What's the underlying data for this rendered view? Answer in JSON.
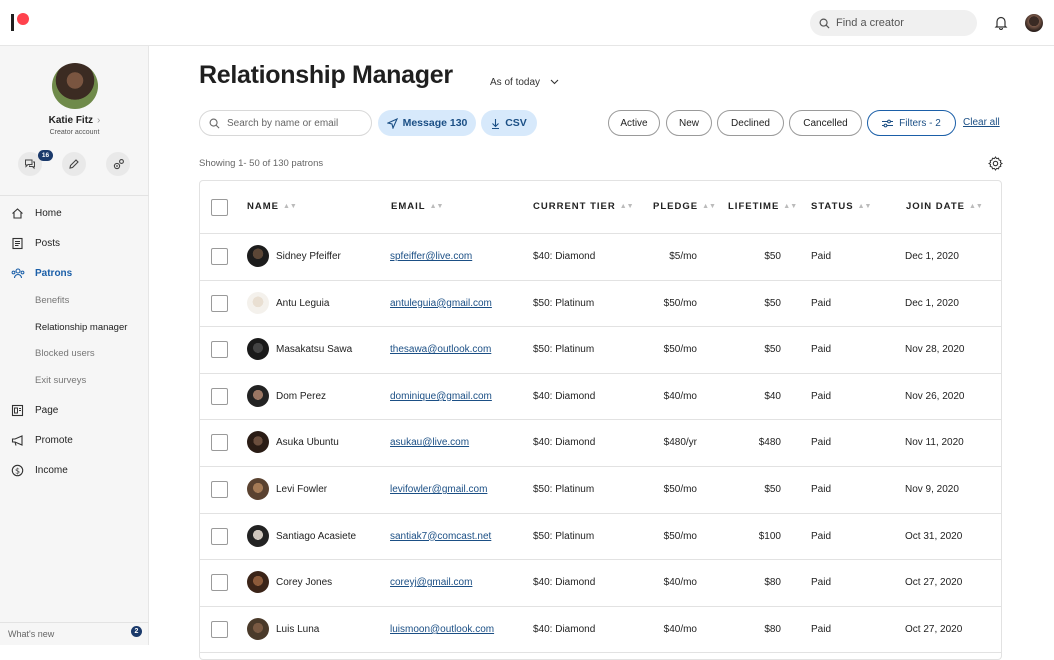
{
  "topbar": {
    "search_placeholder": "Find a creator"
  },
  "sidebar": {
    "profile_name": "Katie Fitz",
    "profile_role": "Creator account",
    "messages_badge": "16",
    "nav": [
      {
        "label": "Home",
        "icon": "home-icon"
      },
      {
        "label": "Posts",
        "icon": "posts-icon"
      },
      {
        "label": "Patrons",
        "icon": "patrons-icon"
      },
      {
        "label": "Page",
        "icon": "page-icon"
      },
      {
        "label": "Promote",
        "icon": "megaphone-icon"
      },
      {
        "label": "Income",
        "icon": "dollar-icon"
      }
    ],
    "patrons_sub": [
      "Benefits",
      "Relationship manager",
      "Blocked users",
      "Exit surveys"
    ],
    "whats_new": "What's new",
    "whats_new_badge": "2"
  },
  "main": {
    "title": "Relationship Manager",
    "as_of_prefix": "As of",
    "as_of_value": "today",
    "search_placeholder": "Search by name or email",
    "message_label": "Message 130",
    "csv_label": "CSV",
    "filters": [
      "Active",
      "New",
      "Declined",
      "Cancelled"
    ],
    "filters_button": "Filters - 2",
    "clear_all": "Clear all",
    "showing": "Showing 1- 50 of 130 patrons"
  },
  "table": {
    "columns": [
      "NAME",
      "EMAIL",
      "CURRENT TIER",
      "PLEDGE",
      "LIFETIME",
      "STATUS",
      "JOIN DATE"
    ],
    "rows": [
      {
        "name": "Sidney Pfeiffer",
        "email": "spfeiffer@live.com",
        "tier": "$40: Diamond",
        "pledge": "$5/mo",
        "lifetime": "$50",
        "status": "Paid",
        "join": "Dec 1, 2020"
      },
      {
        "name": "Antu Leguia",
        "email": "antuleguia@gmail.com",
        "tier": "$50: Platinum",
        "pledge": "$50/mo",
        "lifetime": "$50",
        "status": "Paid",
        "join": "Dec 1, 2020"
      },
      {
        "name": "Masakatsu Sawa",
        "email": "thesawa@outlook.com",
        "tier": "$50: Platinum",
        "pledge": "$50/mo",
        "lifetime": "$50",
        "status": "Paid",
        "join": "Nov 28, 2020"
      },
      {
        "name": "Dom Perez",
        "email": "dominique@gmail.com",
        "tier": "$40: Diamond",
        "pledge": "$40/mo",
        "lifetime": "$40",
        "status": "Paid",
        "join": "Nov 26, 2020"
      },
      {
        "name": "Asuka Ubuntu",
        "email": "asukau@live.com",
        "tier": "$40: Diamond",
        "pledge": "$480/yr",
        "lifetime": "$480",
        "status": "Paid",
        "join": "Nov 11, 2020"
      },
      {
        "name": "Levi Fowler",
        "email": "levifowler@gmail.com",
        "tier": "$50: Platinum",
        "pledge": "$50/mo",
        "lifetime": "$50",
        "status": "Paid",
        "join": "Nov 9, 2020"
      },
      {
        "name": "Santiago Acasiete",
        "email": "santiak7@comcast.net",
        "tier": "$50: Platinum",
        "pledge": "$50/mo",
        "lifetime": "$100",
        "status": "Paid",
        "join": "Oct 31, 2020"
      },
      {
        "name": "Corey Jones",
        "email": "coreyj@gmail.com",
        "tier": "$40: Diamond",
        "pledge": "$40/mo",
        "lifetime": "$80",
        "status": "Paid",
        "join": "Oct 27, 2020"
      },
      {
        "name": "Luis Luna",
        "email": "luismoon@outlook.com",
        "tier": "$40: Diamond",
        "pledge": "$40/mo",
        "lifetime": "$80",
        "status": "Paid",
        "join": "Oct 27, 2020"
      }
    ]
  },
  "colors": {
    "brand": "#ff424d",
    "accent": "#1b5fa8",
    "badge": "#1b3a6b",
    "button_blue_bg": "#d7e9fb"
  }
}
